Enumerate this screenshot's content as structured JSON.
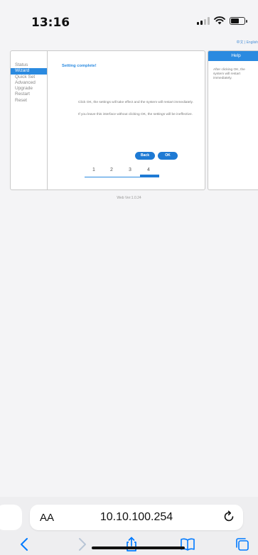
{
  "status_bar": {
    "time": "13:16"
  },
  "lang": "中文 | English",
  "nav": [
    {
      "label": "Status",
      "active": false
    },
    {
      "label": "Wizard",
      "active": true
    },
    {
      "label": "Quick Set",
      "active": false
    },
    {
      "label": "Advanced",
      "active": false
    },
    {
      "label": "Upgrade",
      "active": false
    },
    {
      "label": "Restart",
      "active": false
    },
    {
      "label": "Reset",
      "active": false
    }
  ],
  "main": {
    "title": "Setting complete!",
    "message1": "Click OK, the settings will take effect and the system will restart immediately.",
    "message2": "If you leave this interface without clicking OK, the settings will be ineffective.",
    "back_label": "Back",
    "ok_label": "OK",
    "steps": [
      "1",
      "2",
      "3",
      "4"
    ],
    "current_step": 4
  },
  "help": {
    "title": "Help",
    "text": "After clicking OK, the system will restart immediately."
  },
  "version": "Web Ver:1.0.24",
  "browser": {
    "aa_label": "AA",
    "url": "10.10.100.254"
  },
  "colors": {
    "accent": "#2a8ae0",
    "button": "#1e7ad4",
    "ios_blue": "#007aff"
  }
}
